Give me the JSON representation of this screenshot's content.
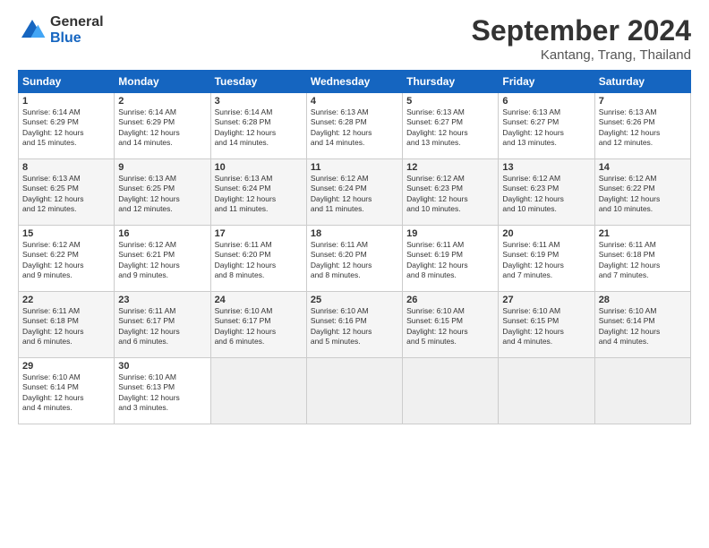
{
  "header": {
    "logo_general": "General",
    "logo_blue": "Blue",
    "month_title": "September 2024",
    "location": "Kantang, Trang, Thailand"
  },
  "weekdays": [
    "Sunday",
    "Monday",
    "Tuesday",
    "Wednesday",
    "Thursday",
    "Friday",
    "Saturday"
  ],
  "weeks": [
    [
      {
        "day": "1",
        "sunrise": "6:14 AM",
        "sunset": "6:29 PM",
        "daylight": "12 hours and 15 minutes."
      },
      {
        "day": "2",
        "sunrise": "6:14 AM",
        "sunset": "6:29 PM",
        "daylight": "12 hours and 14 minutes."
      },
      {
        "day": "3",
        "sunrise": "6:14 AM",
        "sunset": "6:28 PM",
        "daylight": "12 hours and 14 minutes."
      },
      {
        "day": "4",
        "sunrise": "6:13 AM",
        "sunset": "6:28 PM",
        "daylight": "12 hours and 14 minutes."
      },
      {
        "day": "5",
        "sunrise": "6:13 AM",
        "sunset": "6:27 PM",
        "daylight": "12 hours and 13 minutes."
      },
      {
        "day": "6",
        "sunrise": "6:13 AM",
        "sunset": "6:27 PM",
        "daylight": "12 hours and 13 minutes."
      },
      {
        "day": "7",
        "sunrise": "6:13 AM",
        "sunset": "6:26 PM",
        "daylight": "12 hours and 12 minutes."
      }
    ],
    [
      {
        "day": "8",
        "sunrise": "6:13 AM",
        "sunset": "6:25 PM",
        "daylight": "12 hours and 12 minutes."
      },
      {
        "day": "9",
        "sunrise": "6:13 AM",
        "sunset": "6:25 PM",
        "daylight": "12 hours and 12 minutes."
      },
      {
        "day": "10",
        "sunrise": "6:13 AM",
        "sunset": "6:24 PM",
        "daylight": "12 hours and 11 minutes."
      },
      {
        "day": "11",
        "sunrise": "6:12 AM",
        "sunset": "6:24 PM",
        "daylight": "12 hours and 11 minutes."
      },
      {
        "day": "12",
        "sunrise": "6:12 AM",
        "sunset": "6:23 PM",
        "daylight": "12 hours and 10 minutes."
      },
      {
        "day": "13",
        "sunrise": "6:12 AM",
        "sunset": "6:23 PM",
        "daylight": "12 hours and 10 minutes."
      },
      {
        "day": "14",
        "sunrise": "6:12 AM",
        "sunset": "6:22 PM",
        "daylight": "12 hours and 10 minutes."
      }
    ],
    [
      {
        "day": "15",
        "sunrise": "6:12 AM",
        "sunset": "6:22 PM",
        "daylight": "12 hours and 9 minutes."
      },
      {
        "day": "16",
        "sunrise": "6:12 AM",
        "sunset": "6:21 PM",
        "daylight": "12 hours and 9 minutes."
      },
      {
        "day": "17",
        "sunrise": "6:11 AM",
        "sunset": "6:20 PM",
        "daylight": "12 hours and 8 minutes."
      },
      {
        "day": "18",
        "sunrise": "6:11 AM",
        "sunset": "6:20 PM",
        "daylight": "12 hours and 8 minutes."
      },
      {
        "day": "19",
        "sunrise": "6:11 AM",
        "sunset": "6:19 PM",
        "daylight": "12 hours and 8 minutes."
      },
      {
        "day": "20",
        "sunrise": "6:11 AM",
        "sunset": "6:19 PM",
        "daylight": "12 hours and 7 minutes."
      },
      {
        "day": "21",
        "sunrise": "6:11 AM",
        "sunset": "6:18 PM",
        "daylight": "12 hours and 7 minutes."
      }
    ],
    [
      {
        "day": "22",
        "sunrise": "6:11 AM",
        "sunset": "6:18 PM",
        "daylight": "12 hours and 6 minutes."
      },
      {
        "day": "23",
        "sunrise": "6:11 AM",
        "sunset": "6:17 PM",
        "daylight": "12 hours and 6 minutes."
      },
      {
        "day": "24",
        "sunrise": "6:10 AM",
        "sunset": "6:17 PM",
        "daylight": "12 hours and 6 minutes."
      },
      {
        "day": "25",
        "sunrise": "6:10 AM",
        "sunset": "6:16 PM",
        "daylight": "12 hours and 5 minutes."
      },
      {
        "day": "26",
        "sunrise": "6:10 AM",
        "sunset": "6:15 PM",
        "daylight": "12 hours and 5 minutes."
      },
      {
        "day": "27",
        "sunrise": "6:10 AM",
        "sunset": "6:15 PM",
        "daylight": "12 hours and 4 minutes."
      },
      {
        "day": "28",
        "sunrise": "6:10 AM",
        "sunset": "6:14 PM",
        "daylight": "12 hours and 4 minutes."
      }
    ],
    [
      {
        "day": "29",
        "sunrise": "6:10 AM",
        "sunset": "6:14 PM",
        "daylight": "12 hours and 4 minutes."
      },
      {
        "day": "30",
        "sunrise": "6:10 AM",
        "sunset": "6:13 PM",
        "daylight": "12 hours and 3 minutes."
      },
      null,
      null,
      null,
      null,
      null
    ]
  ]
}
